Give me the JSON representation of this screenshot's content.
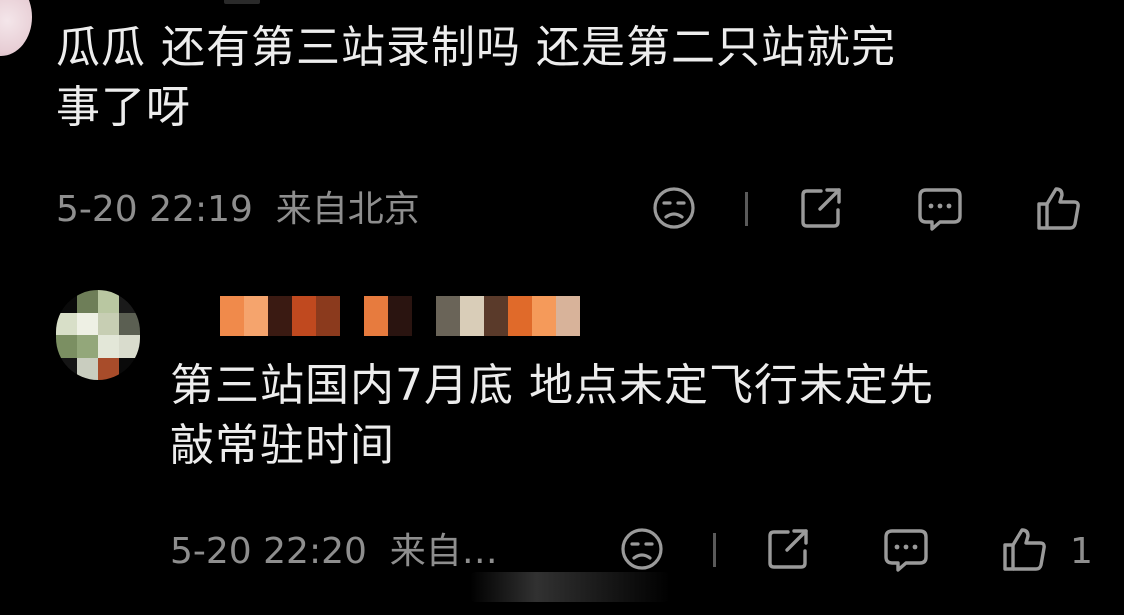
{
  "comments": [
    {
      "text_line1": "瓜瓜  还有第三站录制吗  还是第二只站就完",
      "text_line2": "事了呀",
      "date": "5-20 22:19",
      "location": "来自北京",
      "likes": ""
    },
    {
      "text_line1": "第三站国内7月底 地点未定飞行未定先",
      "text_line2": "敲常驻时间",
      "date": "5-20 22:20",
      "location": "来自…",
      "likes": "1"
    }
  ],
  "icons": [
    "sad-face-icon",
    "share-icon",
    "comment-icon",
    "like-icon"
  ],
  "colors": {
    "background": "#000000",
    "text": "#ededed",
    "meta": "#8e8e8e",
    "icon": "#9a9a9a"
  }
}
